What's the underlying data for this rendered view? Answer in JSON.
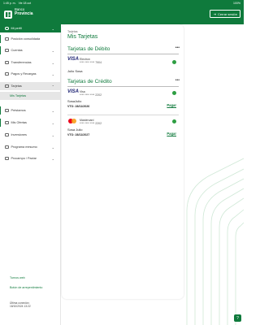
{
  "status_bar": {
    "time": "1:45 p. m.",
    "date": "Vie 18 oct",
    "battery": "100%"
  },
  "header": {
    "brand_line1": "Banco",
    "brand_line2": "Provincia",
    "logout_label": "Cerrar sesión"
  },
  "colors": {
    "brand": "#0f7a3c",
    "status_ok": "#2e9e43",
    "visa": "#1a1f71"
  },
  "sidebar": {
    "items": [
      {
        "label": "Mi perfil",
        "icon": "profile-icon"
      },
      {
        "label": "Posición consolidada",
        "icon": "chart-icon"
      },
      {
        "label": "Cuentas",
        "icon": "wallet-icon"
      },
      {
        "label": "Transferencias",
        "icon": "transfer-icon"
      },
      {
        "label": "Pagos y Recargas",
        "icon": "payments-icon"
      },
      {
        "label": "Tarjetas",
        "icon": "card-icon"
      },
      {
        "label": "Mis Tarjetas",
        "icon": ""
      },
      {
        "label": "Préstamos",
        "icon": "loan-icon"
      },
      {
        "label": "Mis Ofertas",
        "icon": "offers-icon"
      },
      {
        "label": "Inversiones",
        "icon": "invest-icon"
      },
      {
        "label": "Programa mesumo",
        "icon": "program-icon"
      },
      {
        "label": "Procampo / Pactar",
        "icon": "agro-icon"
      }
    ],
    "links": [
      "Turnos web",
      "Botón de arrepentimiento"
    ],
    "last_connection_label": "Última conexión:",
    "last_connection_value": "18/10/2024 13:22"
  },
  "main": {
    "breadcrumb": "Tarjetas",
    "title": "Mis Tarjetas",
    "debit_section": "Tarjetas de Débito",
    "credit_section": "Tarjetas de Crédito",
    "more_icon": "more-horizontal-icon",
    "debit_cards": [
      {
        "network": "VISA",
        "brand": "Electron",
        "number": "**** **** **** 7904",
        "holder": "Julio Sosa"
      }
    ],
    "credit_cards": [
      {
        "network": "VISA",
        "brand": "Visa",
        "number": "**** **** **** 2202",
        "holder": "SosaJulio",
        "vto": "VTO: 28/11/2026",
        "pay_label": "Pagar"
      },
      {
        "network": "mastercard",
        "brand": "Mastercard",
        "number": "**** **** **** 2202",
        "holder": "Sosa Julio",
        "vto": "VTO: 28/11/2027",
        "pay_label": "Pagar"
      }
    ]
  }
}
